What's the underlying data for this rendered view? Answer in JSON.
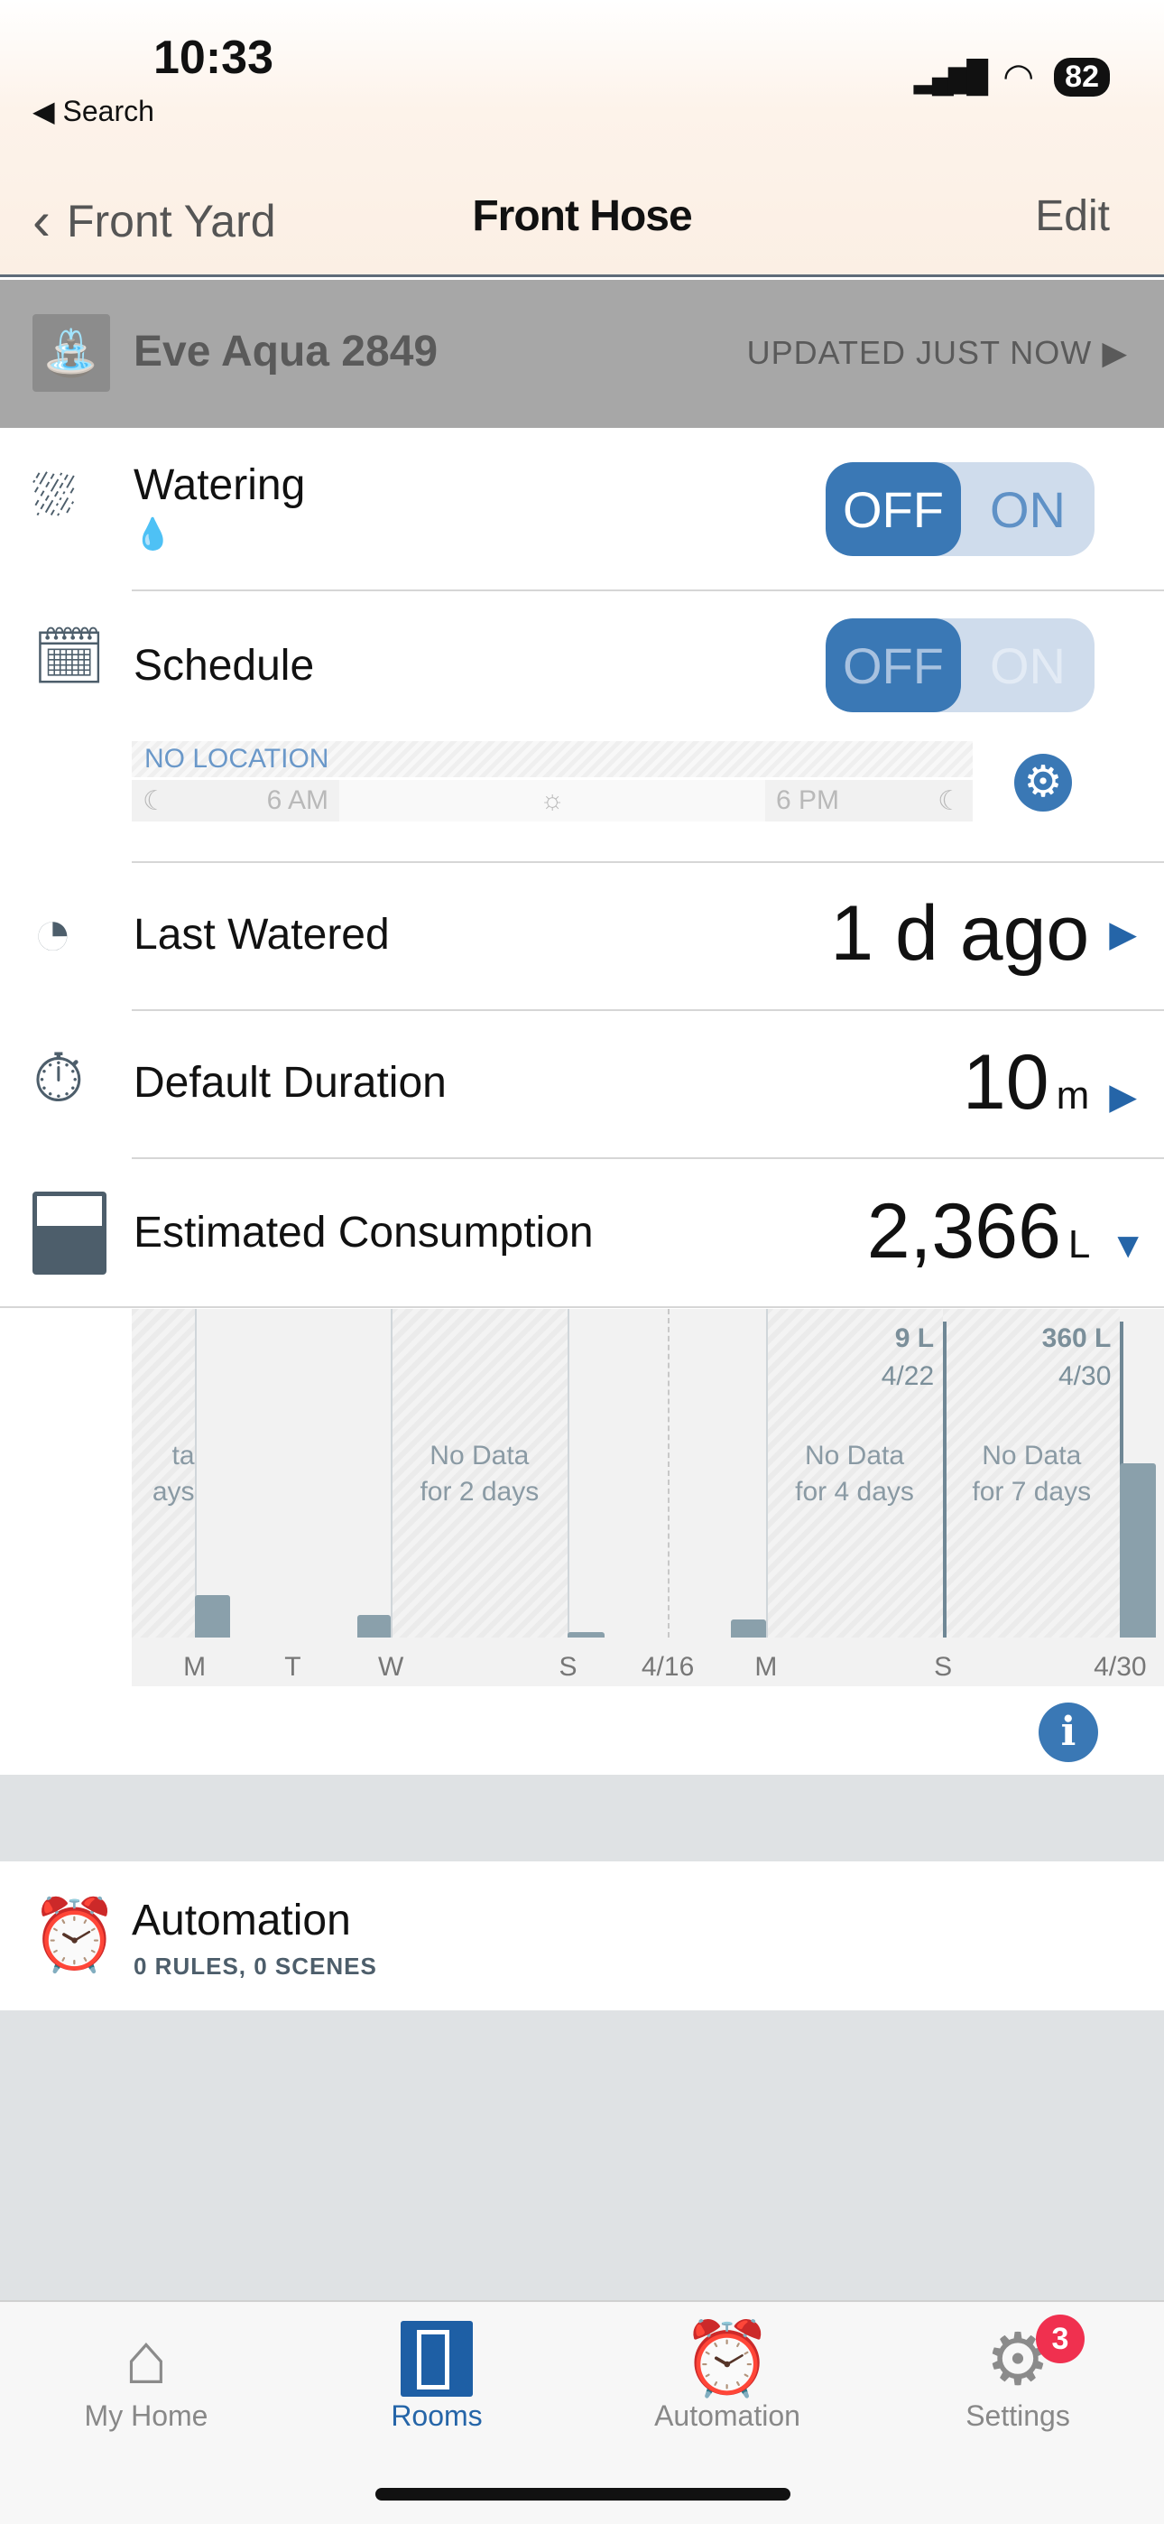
{
  "status_bar": {
    "time": "10:33",
    "back_app": "Search",
    "battery": "82"
  },
  "nav": {
    "back_label": "Front Yard",
    "title": "Front Hose",
    "edit_label": "Edit"
  },
  "device": {
    "name": "Eve Aqua 2849",
    "updated": "UPDATED JUST NOW"
  },
  "watering": {
    "label": "Watering",
    "off_label": "OFF",
    "on_label": "ON",
    "state": "off"
  },
  "schedule": {
    "label": "Schedule",
    "off_label": "OFF",
    "on_label": "ON",
    "state": "off",
    "location": "NO LOCATION",
    "am_label": "6 AM",
    "pm_label": "6 PM"
  },
  "last_watered": {
    "label": "Last Watered",
    "value": "1 d ago"
  },
  "default_duration": {
    "label": "Default Duration",
    "value": "10",
    "unit": "m"
  },
  "consumption": {
    "label": "Estimated Consumption",
    "value": "2,366",
    "unit": "L"
  },
  "chart_data": {
    "type": "bar",
    "x_labels": [
      "M",
      "T",
      "W",
      "S",
      "4/16",
      "M",
      "S",
      "4/30"
    ],
    "bars": [
      {
        "day": "M",
        "value": 87
      },
      {
        "day": "W",
        "value": 47
      },
      {
        "day": "S",
        "value": 10
      },
      {
        "day": "M",
        "value": 37
      },
      {
        "day": "4/30",
        "value": 360
      }
    ],
    "no_data": [
      {
        "line1": "ta",
        "line2": "ays"
      },
      {
        "line1": "No Data",
        "line2": "for 2 days"
      },
      {
        "line1": "No Data",
        "line2": "for 4 days"
      },
      {
        "line1": "No Data",
        "line2": "for 7 days"
      }
    ],
    "annotations": [
      {
        "value": "9 L",
        "date": "4/22"
      },
      {
        "value": "360 L",
        "date": "4/30"
      }
    ],
    "bar_color": "#8aa0ab"
  },
  "automation": {
    "label": "Automation",
    "sub": "0 RULES, 0 SCENES"
  },
  "tabs": [
    {
      "label": "My Home",
      "icon": "house-icon"
    },
    {
      "label": "Rooms",
      "icon": "door-icon",
      "active": true
    },
    {
      "label": "Automation",
      "icon": "automation-icon"
    },
    {
      "label": "Settings",
      "icon": "gear-icon",
      "badge": "3"
    }
  ],
  "colors": {
    "accent": "#3a78b5",
    "inactive": "#888888",
    "badge": "#f0304f"
  }
}
